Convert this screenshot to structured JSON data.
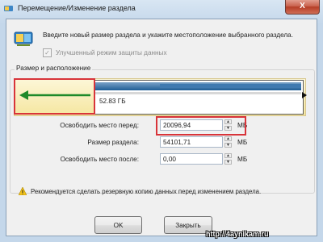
{
  "window": {
    "title": "Перемещение/Изменение раздела",
    "close_glyph": "X"
  },
  "header": {
    "instruction": "Введите новый размер раздела и укажите местоположение выбранного раздела.",
    "checkbox_label": "Улучшенный режим защиты данных",
    "checkbox_checked": true,
    "icon": "partition-disk-icon"
  },
  "section": {
    "label": "Размер и расположение"
  },
  "slider": {
    "size_label": "52.83 ГБ"
  },
  "fields": [
    {
      "label": "Освободить место перед:",
      "value": "20096,94",
      "unit": "МБ"
    },
    {
      "label": "Размер раздела:",
      "value": "54101,71",
      "unit": "МБ"
    },
    {
      "label": "Освободить место после:",
      "value": "0,00",
      "unit": "МБ"
    }
  ],
  "warning": {
    "text": "Рекомендуется сделать резервную копию данных перед изменением раздела.",
    "icon": "warning-icon"
  },
  "buttons": {
    "ok": "OK",
    "close": "Закрыть"
  },
  "watermark": "http://4aynikam.ru",
  "colors": {
    "highlight_red": "#d8343a",
    "arrow_green": "#1f8a2a",
    "bar_blue": "#1f5d96"
  }
}
